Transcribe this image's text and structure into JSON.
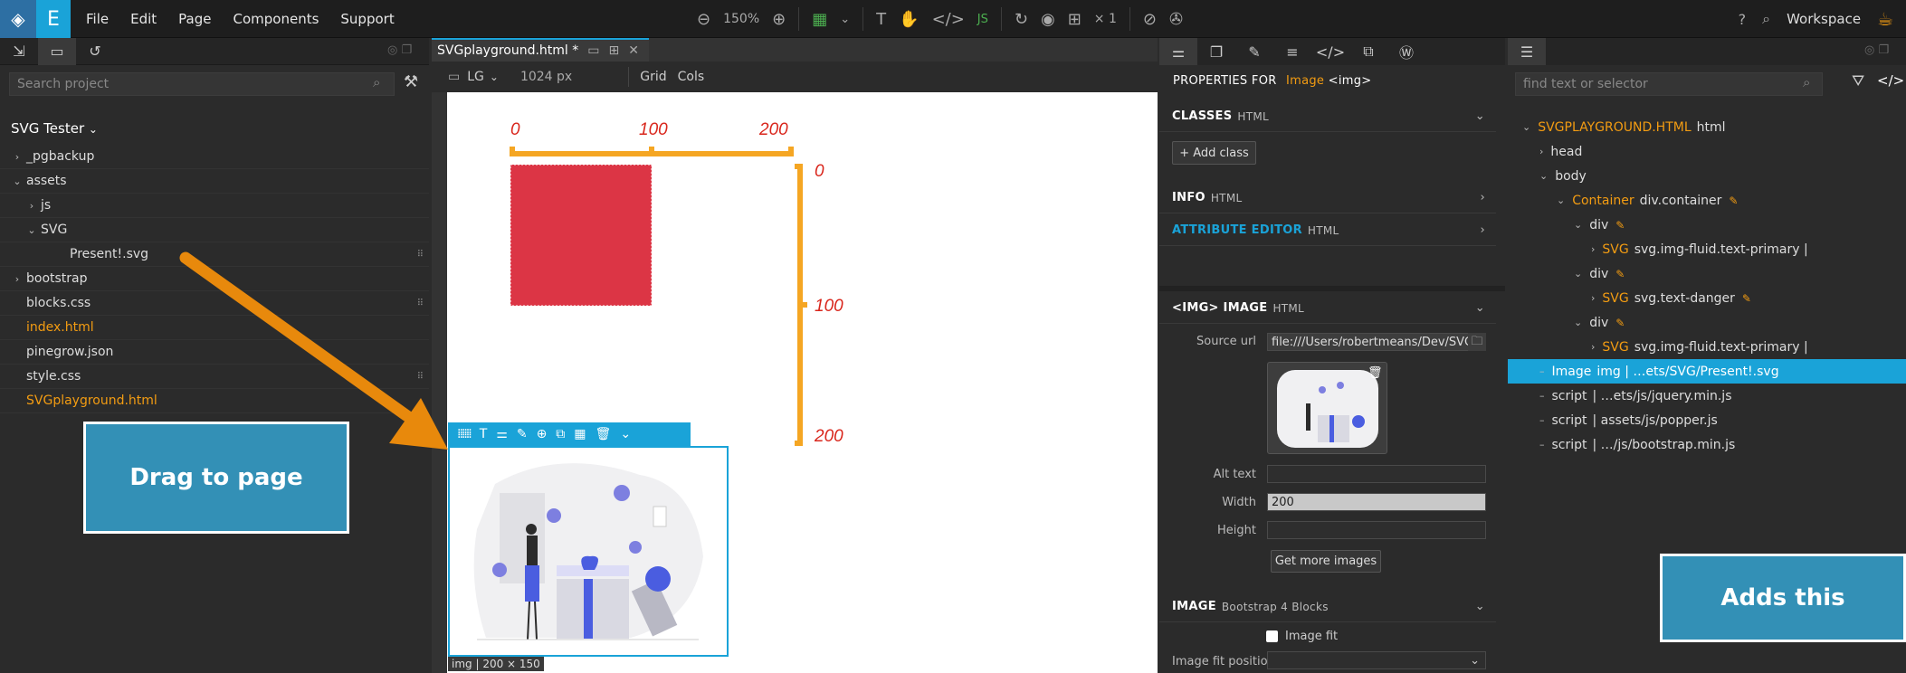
{
  "topbar": {
    "menu": [
      "File",
      "Edit",
      "Page",
      "Components",
      "Support"
    ],
    "zoom": "150%",
    "multiplier": "× 1",
    "workspace": "Workspace"
  },
  "left_panel": {
    "search_placeholder": "Search project",
    "project_name": "SVG Tester",
    "tree": [
      {
        "label": "_pgbackup",
        "indent": 0,
        "arrow": "›",
        "highlight": false,
        "grip": false
      },
      {
        "label": "assets",
        "indent": 0,
        "arrow": "⌄",
        "highlight": false,
        "grip": false
      },
      {
        "label": "js",
        "indent": 1,
        "arrow": "›",
        "highlight": false,
        "grip": false
      },
      {
        "label": "SVG",
        "indent": 1,
        "arrow": "⌄",
        "highlight": false,
        "grip": false
      },
      {
        "label": "Present!.svg",
        "indent": 3,
        "arrow": "",
        "highlight": false,
        "grip": true
      },
      {
        "label": "bootstrap",
        "indent": 0,
        "arrow": "›",
        "highlight": false,
        "grip": false
      },
      {
        "label": "blocks.css",
        "indent": 0,
        "arrow": "",
        "highlight": false,
        "grip": true
      },
      {
        "label": "index.html",
        "indent": 0,
        "arrow": "",
        "highlight": true,
        "grip": false
      },
      {
        "label": "pinegrow.json",
        "indent": 0,
        "arrow": "",
        "highlight": false,
        "grip": false
      },
      {
        "label": "style.css",
        "indent": 0,
        "arrow": "",
        "highlight": false,
        "grip": true
      },
      {
        "label": "SVGplayground.html",
        "indent": 0,
        "arrow": "",
        "highlight": true,
        "grip": false
      }
    ]
  },
  "callouts": {
    "drag": "Drag to page",
    "adds": "Adds this"
  },
  "doc": {
    "tab_title": "SVGplayground.html *",
    "viewport": "LG",
    "width": "1024 px",
    "grid": "Grid",
    "cols": "Cols",
    "ruler_x": [
      "0",
      "100",
      "200"
    ],
    "ruler_y": [
      "0",
      "100",
      "200"
    ],
    "img_label": "img | 200 × 150"
  },
  "colors": {
    "accent": "#1aa3d8",
    "orange": "#f39c12",
    "ruler": "#f5a623",
    "danger": "#dc3545",
    "callout": "#3390b6"
  },
  "props": {
    "header_prefix": "PROPERTIES FOR",
    "header_name": "Image",
    "header_tag": "<img>",
    "sections": [
      {
        "title": "CLASSES",
        "sub": "HTML"
      },
      {
        "title": "INFO",
        "sub": "HTML"
      },
      {
        "title": "ATTRIBUTE EDITOR",
        "sub": "HTML"
      }
    ],
    "add_class": "+ Add class",
    "img_section_title": "<IMG> IMAGE",
    "img_section_sub": "HTML",
    "source_label": "Source url",
    "source_value": "file:///Users/robertmeans/Dev/SVG",
    "alt_label": "Alt text",
    "alt_value": "",
    "width_label": "Width",
    "width_value": "200",
    "height_label": "Height",
    "height_value": "",
    "more_images": "Get more images",
    "image_section_title": "IMAGE",
    "image_section_sub": "Bootstrap 4 Blocks",
    "image_fit": "Image fit",
    "image_fit_pos": "Image fit position"
  },
  "elements": {
    "search_placeholder": "find text or selector",
    "rows": [
      {
        "name": "SVGPLAYGROUND.HTML",
        "rest": "html",
        "indent": 0,
        "chev": "⌄",
        "sel": false,
        "pencil": false
      },
      {
        "name": "",
        "rest": "head",
        "indent": 1,
        "chev": "›",
        "sel": false,
        "pencil": false
      },
      {
        "name": "",
        "rest": "body",
        "indent": 1,
        "chev": "⌄",
        "sel": false,
        "pencil": false
      },
      {
        "name": "Container",
        "rest": "div.container",
        "indent": 2,
        "chev": "⌄",
        "sel": false,
        "pencil": true
      },
      {
        "name": "",
        "rest": "div",
        "indent": 3,
        "chev": "⌄",
        "sel": false,
        "pencil": true
      },
      {
        "name": "SVG",
        "rest": "svg.img-fluid.text-primary |",
        "indent": 4,
        "chev": "›",
        "sel": false,
        "pencil": false
      },
      {
        "name": "",
        "rest": "div",
        "indent": 3,
        "chev": "⌄",
        "sel": false,
        "pencil": true
      },
      {
        "name": "SVG",
        "rest": "svg.text-danger",
        "indent": 4,
        "chev": "›",
        "sel": false,
        "pencil": true
      },
      {
        "name": "",
        "rest": "div",
        "indent": 3,
        "chev": "⌄",
        "sel": false,
        "pencil": true
      },
      {
        "name": "SVG",
        "rest": "svg.img-fluid.text-primary |",
        "indent": 4,
        "chev": "›",
        "sel": false,
        "pencil": false
      },
      {
        "name": "Image",
        "rest": "img | …ets/SVG/Present!.svg",
        "indent": 1,
        "chev": "–",
        "sel": true,
        "pencil": false
      },
      {
        "name": "script",
        "rest": "| …ets/js/jquery.min.js",
        "indent": 1,
        "chev": "–",
        "sel": false,
        "pencil": false
      },
      {
        "name": "script",
        "rest": "| assets/js/popper.js",
        "indent": 1,
        "chev": "–",
        "sel": false,
        "pencil": false
      },
      {
        "name": "script",
        "rest": "| …/js/bootstrap.min.js",
        "indent": 1,
        "chev": "–",
        "sel": false,
        "pencil": false
      }
    ]
  }
}
